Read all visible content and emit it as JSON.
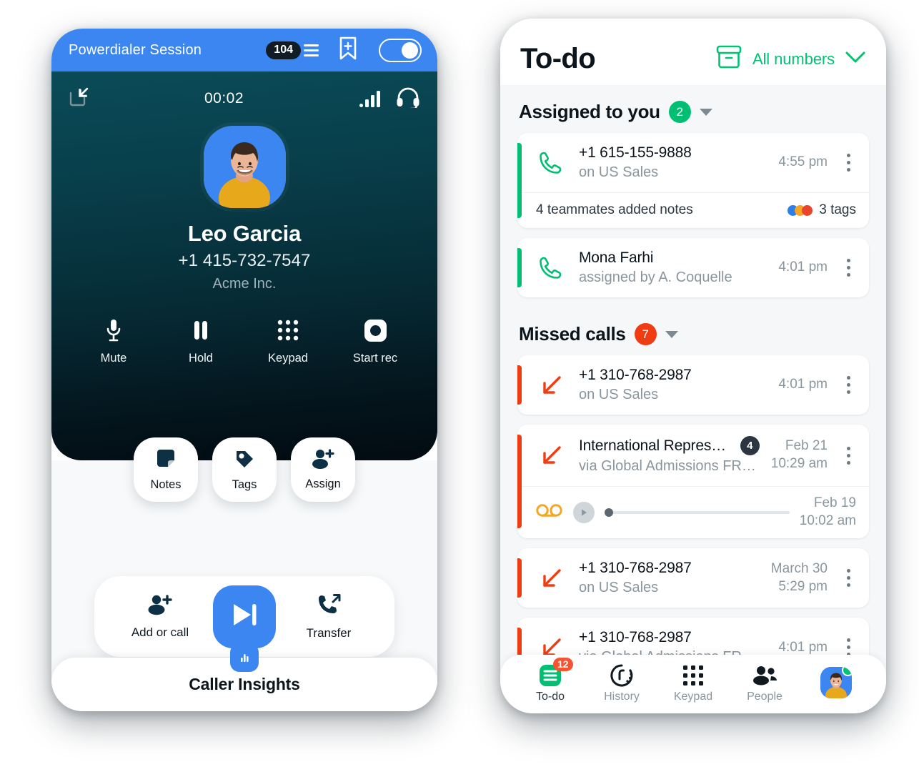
{
  "left_phone": {
    "header": {
      "title": "Powerdialer Session",
      "queue_count": "104",
      "menu_icon": "hamburger-menu-icon",
      "bookmark_icon": "bookmark-add-icon",
      "toggle_icon": "toggle-switch-on",
      "bg_color": "#3b86f0"
    },
    "status": {
      "minimize_icon": "collapse-window-icon",
      "timer": "00:02",
      "signal_icon": "signal-strength-icon",
      "headset_icon": "headset-icon"
    },
    "caller": {
      "avatar": "caller-avatar-photo",
      "name": "Leo Garcia",
      "number": "+1 415-732-7547",
      "company": "Acme Inc."
    },
    "call_actions": [
      {
        "label": "Mute",
        "icon": "microphone-icon"
      },
      {
        "label": "Hold",
        "icon": "pause-icon"
      },
      {
        "label": "Keypad",
        "icon": "keypad-dots-icon"
      },
      {
        "label": "Start rec",
        "icon": "record-icon"
      }
    ],
    "chips": [
      {
        "label": "Notes",
        "icon": "note-icon"
      },
      {
        "label": "Tags",
        "icon": "tag-icon"
      },
      {
        "label": "Assign",
        "icon": "person-add-icon"
      }
    ],
    "cta": {
      "add_or_call": "Add or call",
      "add_or_call_icon": "person-add-icon",
      "next_icon": "skip-next-icon",
      "transfer": "Transfer",
      "transfer_icon": "call-transfer-icon",
      "accent_color": "#3b86f0"
    },
    "insights": {
      "label": "Caller Insights",
      "icon": "bar-chart-icon"
    }
  },
  "right_phone": {
    "header": {
      "title": "To-do",
      "archive_icon": "archive-box-icon",
      "filter_label": "All numbers",
      "chevron_icon": "chevron-down-icon",
      "accent_color": "#00c374"
    },
    "sections": [
      {
        "title": "Assigned to you",
        "badge": "2",
        "badge_color": "#00bf72",
        "caret_icon": "caret-down-icon",
        "items": [
          {
            "accent": "green",
            "icon": "phone-outline-icon",
            "title": "+1 615-155-9888",
            "subtitle": "on US Sales",
            "time": "4:55 pm",
            "kebab_icon": "more-vertical-icon",
            "sub_row": {
              "left": "4 teammates added notes",
              "right": "3 tags",
              "dot_colors": [
                "#2a7fe8",
                "#f5a623",
                "#e8452c"
              ]
            }
          },
          {
            "accent": "green",
            "icon": "phone-outline-icon",
            "title": "Mona Farhi",
            "subtitle": "assigned by A. Coquelle",
            "time": "4:01 pm",
            "kebab_icon": "more-vertical-icon"
          }
        ]
      },
      {
        "title": "Missed calls",
        "badge": "7",
        "badge_color": "#f03c13",
        "caret_icon": "caret-down-icon",
        "items": [
          {
            "accent": "red",
            "icon": "missed-call-arrow-icon",
            "title": "+1 310-768-2987",
            "subtitle": "on US Sales",
            "time": "4:01 pm",
            "kebab_icon": "more-vertical-icon"
          },
          {
            "accent": "red",
            "icon": "missed-call-arrow-icon",
            "title": "International Representat...",
            "count": "4",
            "subtitle": "via Global Admissions FR [In...",
            "time_date": "Feb 21",
            "time_clock": "10:29 am",
            "kebab_icon": "more-vertical-icon",
            "voicemail": {
              "icon": "voicemail-icon",
              "play_icon": "play-icon",
              "date": "Feb 19",
              "clock": "10:02 am"
            }
          },
          {
            "accent": "red",
            "icon": "missed-call-arrow-icon",
            "title": "+1 310-768-2987",
            "subtitle": "on US Sales",
            "time_date": "March 30",
            "time_clock": "5:29 pm",
            "kebab_icon": "more-vertical-icon"
          },
          {
            "accent": "red",
            "icon": "missed-call-arrow-icon",
            "title": "+1 310-768-2987",
            "subtitle": "via Global Admissions FR",
            "time": "4:01 pm",
            "kebab_icon": "more-vertical-icon"
          }
        ]
      }
    ],
    "nav": [
      {
        "label": "To-do",
        "icon": "todo-list-icon",
        "badge": "12",
        "active": true
      },
      {
        "label": "History",
        "icon": "history-clock-icon",
        "active": false
      },
      {
        "label": "Keypad",
        "icon": "keypad-dots-icon",
        "active": false
      },
      {
        "label": "People",
        "icon": "people-icon",
        "active": false
      },
      {
        "label": "",
        "icon": "profile-avatar-icon",
        "active": false
      }
    ]
  }
}
